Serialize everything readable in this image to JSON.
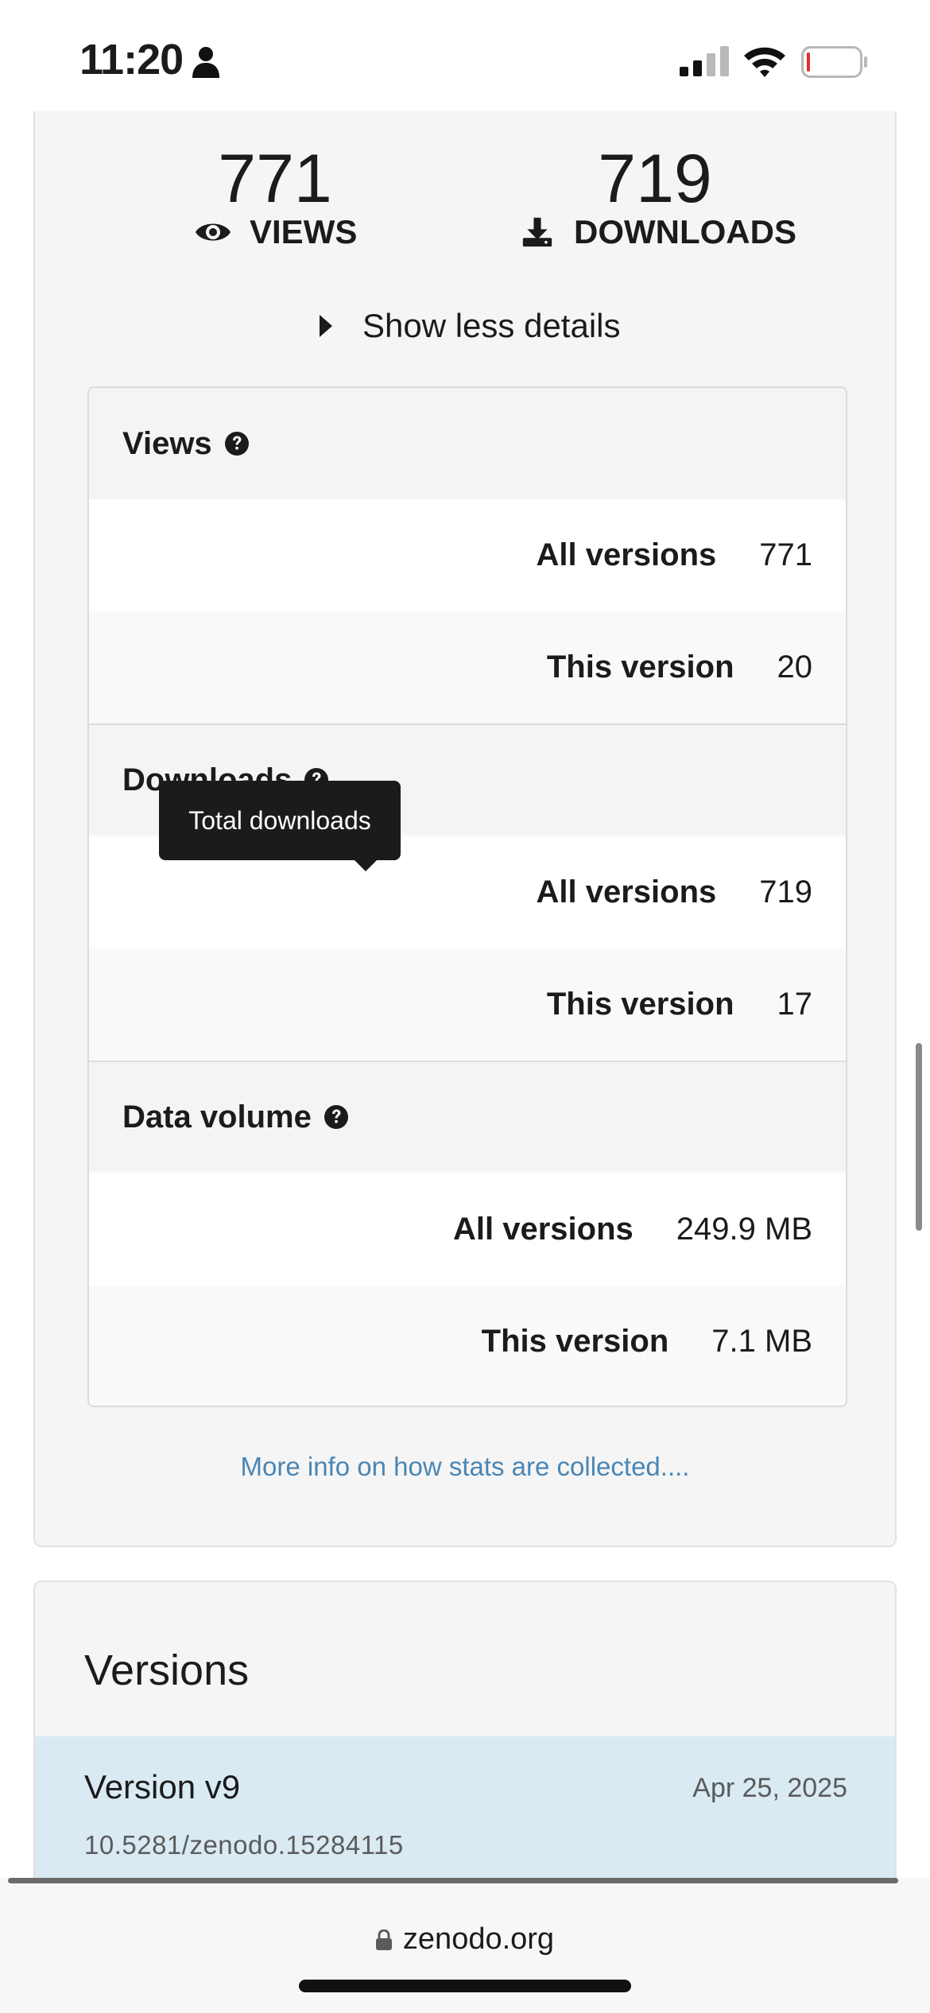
{
  "status_bar": {
    "time": "11:20",
    "icons": [
      "person-icon",
      "signal-icon",
      "wifi-icon",
      "battery-icon"
    ]
  },
  "stats": {
    "views_count": "771",
    "views_label": "VIEWS",
    "downloads_count": "719",
    "downloads_label": "DOWNLOADS",
    "toggle_label": "Show less details",
    "tooltip": "Total downloads",
    "sections": [
      {
        "title": "Views",
        "rows": [
          {
            "label": "All versions",
            "value": "771"
          },
          {
            "label": "This version",
            "value": "20"
          }
        ]
      },
      {
        "title": "Downloads",
        "rows": [
          {
            "label": "All versions",
            "value": "719"
          },
          {
            "label": "This version",
            "value": "17"
          }
        ]
      },
      {
        "title": "Data volume",
        "rows": [
          {
            "label": "All versions",
            "value": "249.9 MB"
          },
          {
            "label": "This version",
            "value": "7.1 MB"
          }
        ]
      }
    ],
    "info_link": "More info on how stats are collected...."
  },
  "versions": {
    "title": "Versions",
    "items": [
      {
        "name": "Version v9",
        "date": "Apr 25, 2025",
        "doi": "10.5281/zenodo.15284115"
      }
    ]
  },
  "browser": {
    "url": "zenodo.org"
  },
  "colors": {
    "link": "#4a86b5",
    "selected_version_bg": "#d9eaf3",
    "card_bg": "#f5f5f5",
    "tooltip_bg": "#1b1b1b"
  }
}
